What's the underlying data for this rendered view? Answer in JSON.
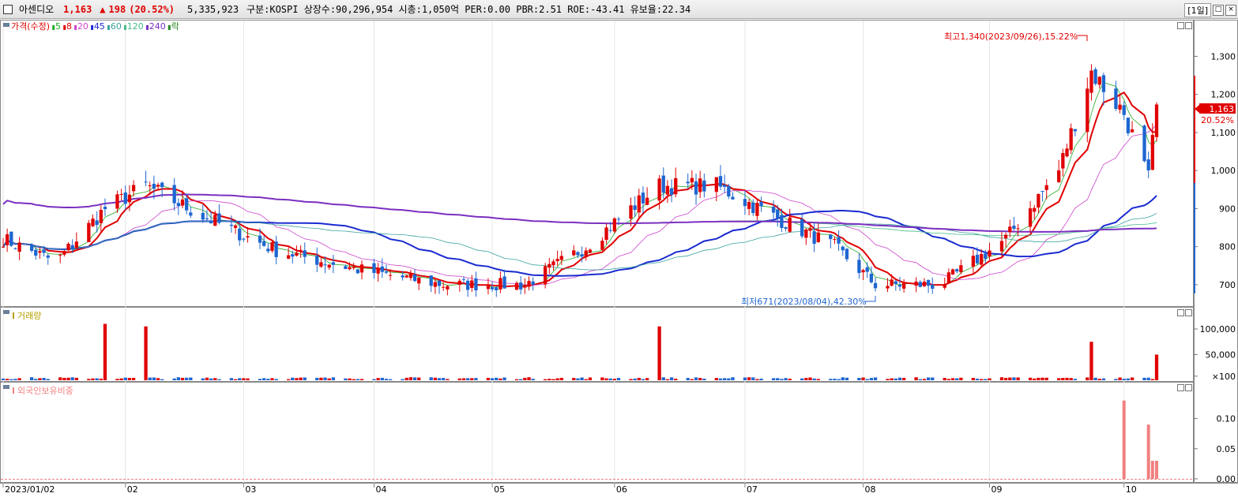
{
  "header": {
    "name": "아센디오",
    "price": "1,163",
    "change_arrow": "▲",
    "change": "198",
    "change_pct": "(20.52%)",
    "volume": "5,335,923",
    "info": "구분:KOSPI 상장수:90,296,954 시총:1,050억 PER:0.00 PBR:2.51 ROE:-43.41 유보율:22.34",
    "period": "[1일]",
    "btn_restore": "□",
    "btn_close": "×"
  },
  "colors": {
    "up": "#e00000",
    "down": "#1e66d0",
    "ma5": "#22aa22",
    "ma8": "#e00000",
    "ma20": "#cc44cc",
    "ma45": "#1a2bd0",
    "ma60": "#3aa0a0",
    "ma120": "#44bb88",
    "ma240": "#7a2fc0",
    "foreign": "#f08080"
  },
  "price_panel": {
    "legend": [
      {
        "text": "가격(수정)",
        "color": "#e00000"
      },
      {
        "text": "5",
        "color": "#22aa22"
      },
      {
        "text": "8",
        "color": "#e00000"
      },
      {
        "text": "20",
        "color": "#cc44cc"
      },
      {
        "text": "45",
        "color": "#1a2bd0"
      },
      {
        "text": "60",
        "color": "#3aa0a0"
      },
      {
        "text": "120",
        "color": "#44bb88"
      },
      {
        "text": "240",
        "color": "#7a2fc0"
      },
      {
        "text": "락",
        "color": "#228822"
      }
    ],
    "high_annotation": "최고1,340(2023/09/26),15.22%",
    "low_annotation": "최저671(2023/08/04),42.30%",
    "current_price_tag": "1,163",
    "current_pct_tag": "20.52%"
  },
  "volume_panel": {
    "legend": "거래량",
    "y_ticks": [
      "100,000",
      "50,000",
      "×100"
    ]
  },
  "foreign_panel": {
    "legend": "외국인보유비중",
    "y_ticks": [
      "0.10",
      "0.05",
      "0.00"
    ]
  },
  "chart_data": {
    "type": "candlestick",
    "x_labels": [
      "2023/01/02",
      "02",
      "03",
      "04",
      "05",
      "06",
      "07",
      "08",
      "09",
      "10"
    ],
    "price_ylim": [
      650,
      1390
    ],
    "price_y_ticks": [
      "1,300",
      "1,200",
      "1,100",
      "1,000",
      "900",
      "800",
      "700"
    ],
    "volume_ylim": [
      0,
      120000
    ],
    "foreign_ylim": [
      0,
      0.14
    ],
    "monthly_close": [
      {
        "month": "2023-01",
        "close": 780
      },
      {
        "month": "2023-02",
        "close": 860
      },
      {
        "month": "2023-03",
        "close": 770
      },
      {
        "month": "2023-04",
        "close": 700
      },
      {
        "month": "2023-05",
        "close": 720
      },
      {
        "month": "2023-06",
        "close": 920
      },
      {
        "month": "2023-07",
        "close": 830
      },
      {
        "month": "2023-08",
        "close": 700
      },
      {
        "month": "2023-09",
        "close": 1200
      },
      {
        "month": "2023-10",
        "close": 1163
      }
    ],
    "high": {
      "date": "2023/09/26",
      "price": 1340
    },
    "low": {
      "date": "2023/08/04",
      "price": 671
    },
    "volume_spikes": [
      {
        "date": "2023-01-27",
        "value": 110000
      },
      {
        "date": "2023-02-06",
        "value": 105000
      },
      {
        "date": "2023-06-12",
        "value": 105000
      },
      {
        "date": "2023-09-26",
        "value": 75000
      },
      {
        "date": "2023-10-12",
        "value": 50000
      }
    ],
    "foreign_ratio": [
      {
        "date": "2023-10-04",
        "value": 0.13
      },
      {
        "date": "2023-10-10",
        "value": 0.09
      },
      {
        "date": "2023-10-11",
        "value": 0.03
      },
      {
        "date": "2023-10-12",
        "value": 0.03
      }
    ]
  }
}
